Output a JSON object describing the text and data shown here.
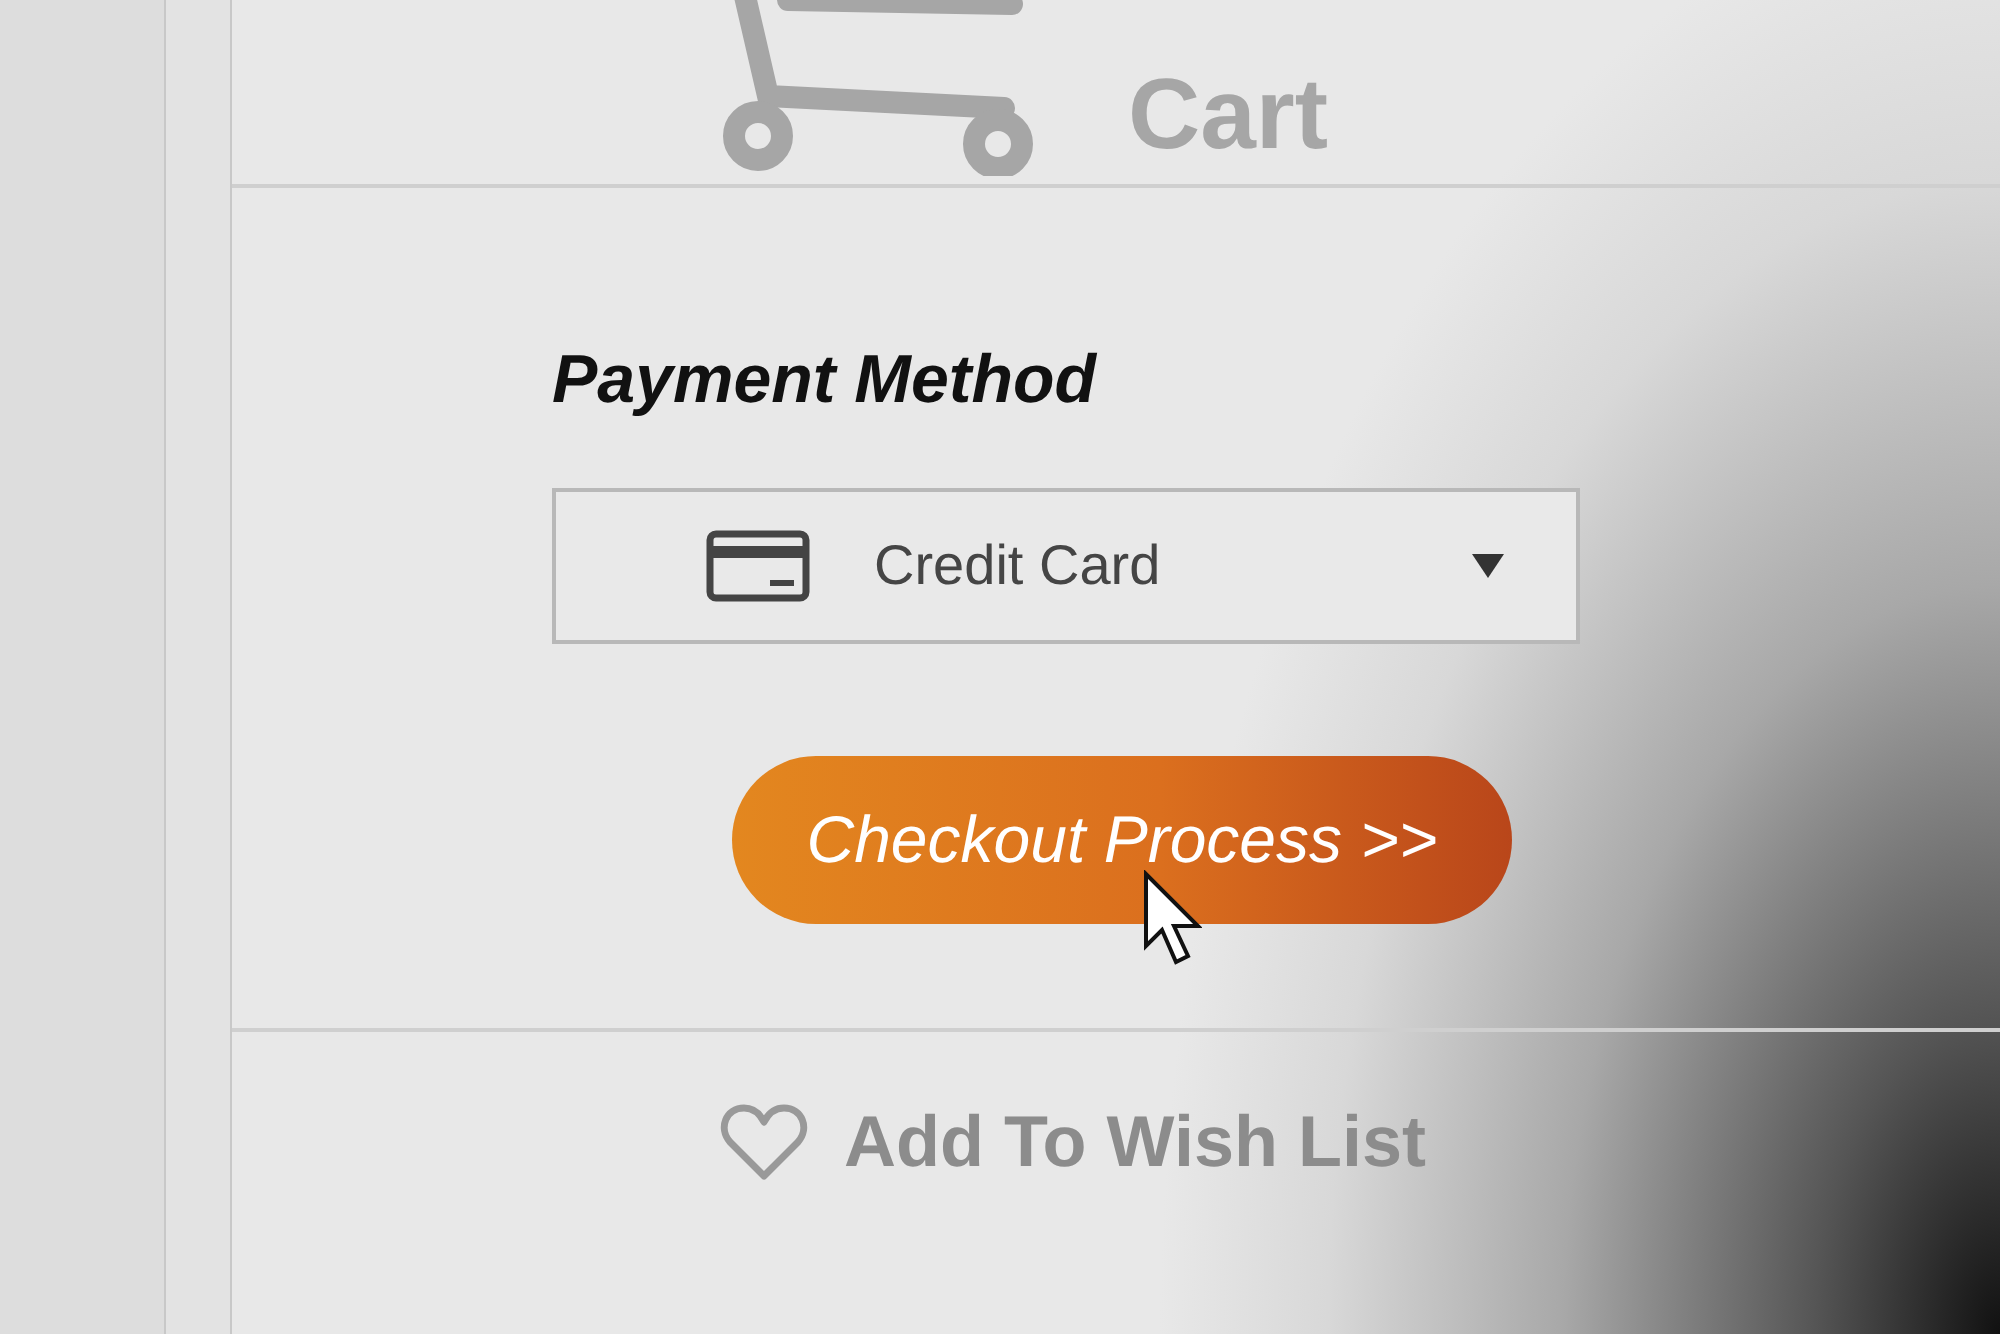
{
  "cart": {
    "label": "Cart"
  },
  "payment": {
    "heading": "Payment Method",
    "dropdown": {
      "value": "Credit Card"
    }
  },
  "checkout_button": {
    "label": "Checkout Process >>"
  },
  "wish_list": {
    "label": "Add To Wish List"
  }
}
